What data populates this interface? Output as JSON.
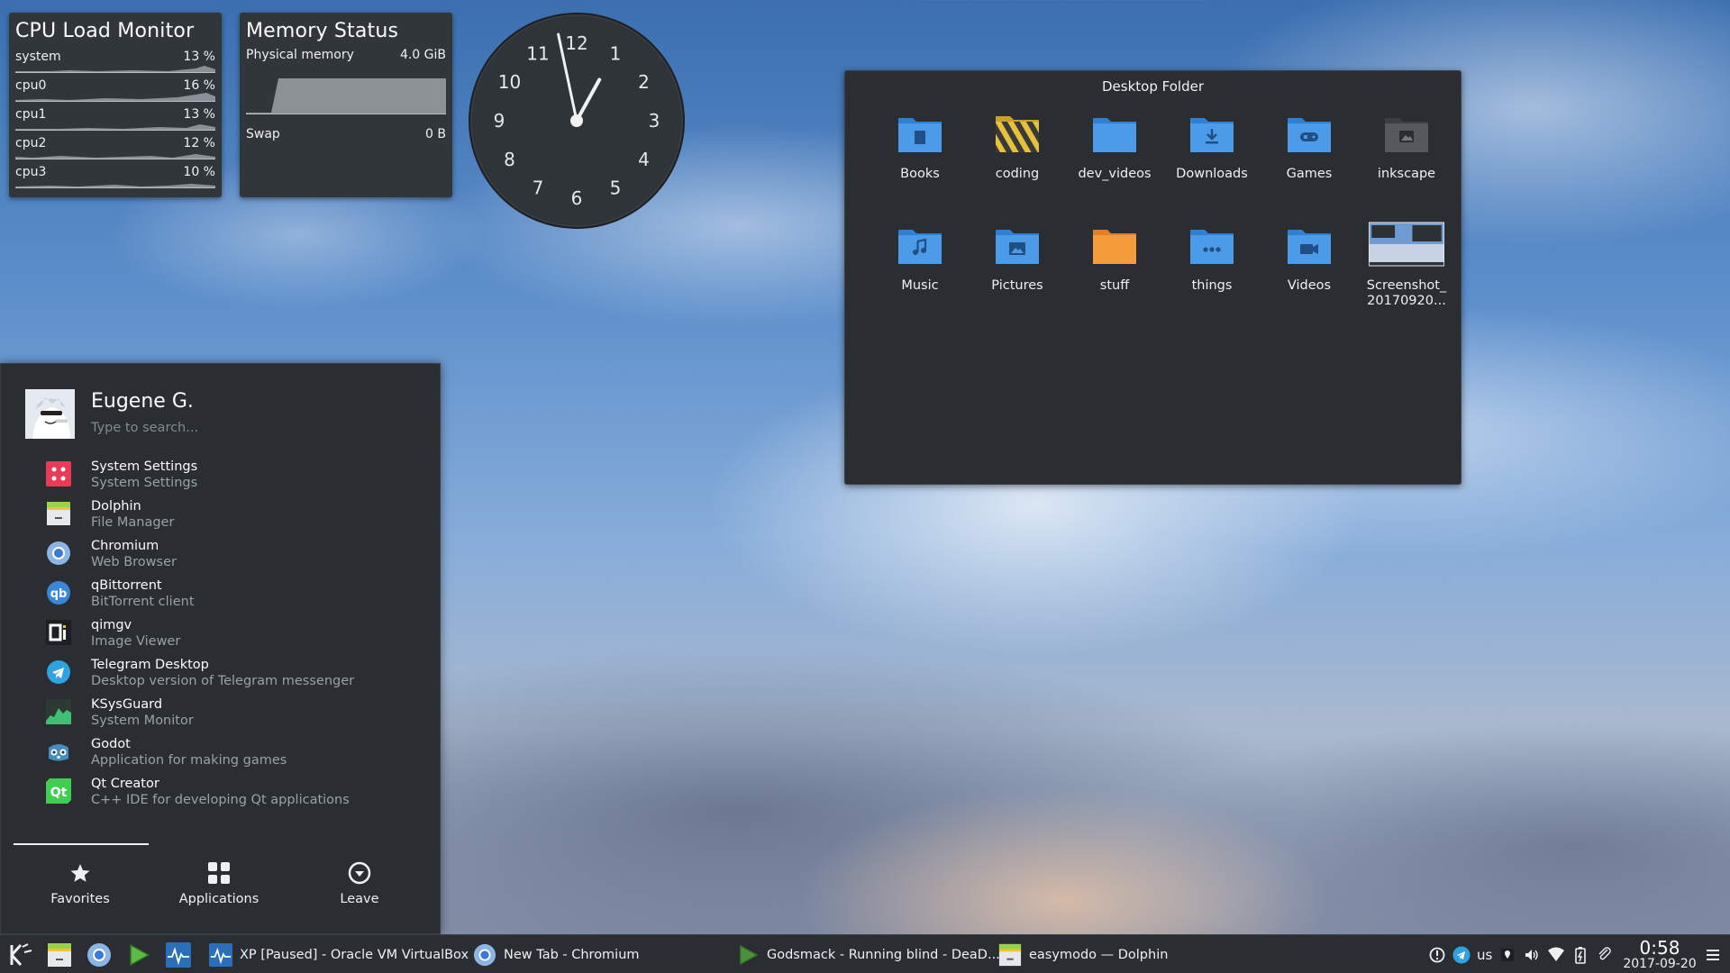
{
  "cpu_widget": {
    "title": "CPU Load Monitor",
    "rows": [
      {
        "label": "system",
        "value": "13 %"
      },
      {
        "label": "cpu0",
        "value": "16 %"
      },
      {
        "label": "cpu1",
        "value": "13 %"
      },
      {
        "label": "cpu2",
        "value": "12 %"
      },
      {
        "label": "cpu3",
        "value": "10 %"
      }
    ]
  },
  "memory_widget": {
    "title": "Memory Status",
    "physical_label": "Physical memory",
    "physical_value": "4.0 GiB",
    "swap_label": "Swap",
    "swap_value": "0 B"
  },
  "analog_clock": {
    "numerals": [
      "12",
      "1",
      "2",
      "3",
      "4",
      "5",
      "6",
      "7",
      "8",
      "9",
      "10",
      "11"
    ],
    "hour": 0,
    "minute": 58
  },
  "desktop_folder": {
    "title": "Desktop Folder",
    "items": [
      {
        "name": "Books",
        "icon": "books-folder-icon"
      },
      {
        "name": "coding",
        "icon": "coding-folder-icon"
      },
      {
        "name": "dev_videos",
        "icon": "folder-icon"
      },
      {
        "name": "Downloads",
        "icon": "downloads-folder-icon"
      },
      {
        "name": "Games",
        "icon": "games-folder-icon"
      },
      {
        "name": "inkscape",
        "icon": "inkscape-folder-icon"
      },
      {
        "name": "Music",
        "icon": "music-folder-icon"
      },
      {
        "name": "Pictures",
        "icon": "pictures-folder-icon"
      },
      {
        "name": "stuff",
        "icon": "orange-folder-icon"
      },
      {
        "name": "things",
        "icon": "things-folder-icon"
      },
      {
        "name": "Videos",
        "icon": "videos-folder-icon"
      },
      {
        "name": "Screenshot_\n20170920...",
        "icon": "screenshot-thumbnail-icon"
      }
    ]
  },
  "app_menu": {
    "user_name": "Eugene G.",
    "search_placeholder": "Type to search...",
    "favorites": [
      {
        "name": "System Settings",
        "desc": "System Settings",
        "icon": "system-settings-icon"
      },
      {
        "name": "Dolphin",
        "desc": "File Manager",
        "icon": "dolphin-icon"
      },
      {
        "name": "Chromium",
        "desc": "Web Browser",
        "icon": "chromium-icon"
      },
      {
        "name": "qBittorrent",
        "desc": "BitTorrent client",
        "icon": "qbittorrent-icon"
      },
      {
        "name": "qimgv",
        "desc": "Image Viewer",
        "icon": "qimgv-icon"
      },
      {
        "name": "Telegram Desktop",
        "desc": "Desktop version of Telegram messenger",
        "icon": "telegram-icon"
      },
      {
        "name": "KSysGuard",
        "desc": "System Monitor",
        "icon": "ksysguard-icon"
      },
      {
        "name": "Godot",
        "desc": "Application for making games",
        "icon": "godot-icon"
      },
      {
        "name": "Qt Creator",
        "desc": "C++ IDE for developing Qt applications",
        "icon": "qt-creator-icon"
      }
    ],
    "tabs": {
      "favorites": "Favorites",
      "applications": "Applications",
      "leave": "Leave"
    }
  },
  "taskbar": {
    "tasks": [
      {
        "label": "XP [Paused] - Oracle VM VirtualBox"
      },
      {
        "label": "New Tab - Chromium"
      },
      {
        "label": "Godsmack - Running blind - DeaD..."
      },
      {
        "label": "easymodo — Dolphin"
      }
    ],
    "keyboard_layout": "us",
    "time": "0:58",
    "date": "2017-09-20"
  },
  "colors": {
    "accent_blue": "#3daee9",
    "folder_blue": "#4c9be8",
    "panel_bg": "#2a2e32"
  }
}
